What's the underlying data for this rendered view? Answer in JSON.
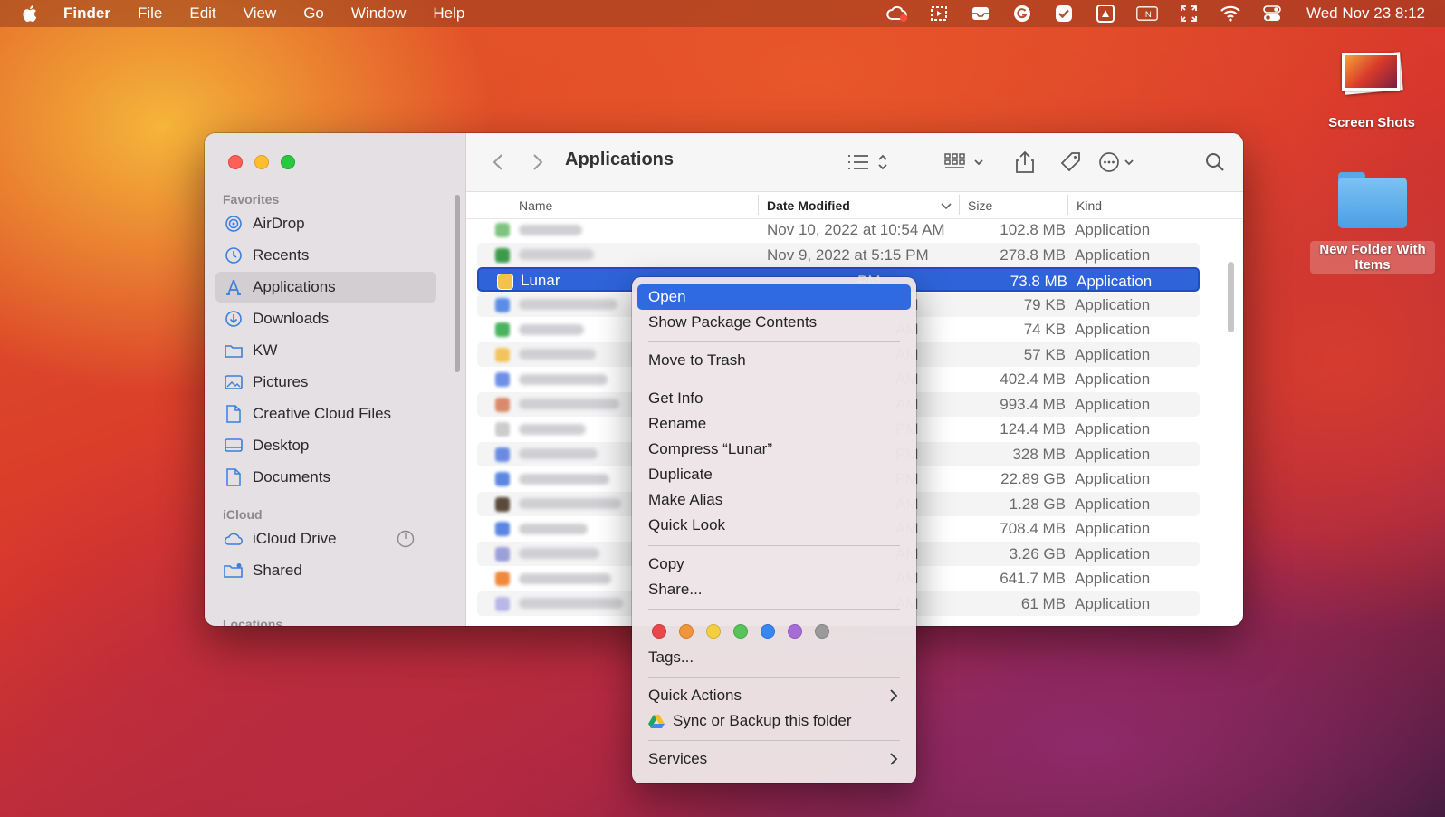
{
  "menubar": {
    "app_name": "Finder",
    "menus": [
      "File",
      "Edit",
      "View",
      "Go",
      "Window",
      "Help"
    ],
    "status_icons": [
      "creative-cloud-icon",
      "screen-capture-icon",
      "inbox-icon",
      "grammarly-icon",
      "checkmark-icon",
      "drive-icon",
      "input-source-icon",
      "fullscreen-icon",
      "wifi-icon",
      "control-center-icon"
    ],
    "input_source": "IN",
    "clock": "Wed Nov 23  8:12"
  },
  "desktop": {
    "items": [
      {
        "label": "Screen Shots"
      },
      {
        "label": "New Folder With Items"
      }
    ]
  },
  "finder": {
    "title": "Applications",
    "sidebar": {
      "favorites_label": "Favorites",
      "favorites": [
        {
          "label": "AirDrop",
          "icon": "airdrop-icon"
        },
        {
          "label": "Recents",
          "icon": "clock-icon"
        },
        {
          "label": "Applications",
          "icon": "applications-icon",
          "active": true
        },
        {
          "label": "Downloads",
          "icon": "download-icon"
        },
        {
          "label": "KW",
          "icon": "folder-icon"
        },
        {
          "label": "Pictures",
          "icon": "pictures-icon"
        },
        {
          "label": "Creative Cloud Files",
          "icon": "document-icon"
        },
        {
          "label": "Desktop",
          "icon": "desktop-icon"
        },
        {
          "label": "Documents",
          "icon": "document-icon"
        }
      ],
      "icloud_label": "iCloud",
      "icloud": [
        {
          "label": "iCloud Drive",
          "icon": "cloud-icon"
        },
        {
          "label": "Shared",
          "icon": "shared-folder-icon"
        }
      ],
      "locations_label": "Locations"
    },
    "columns": {
      "name": "Name",
      "date": "Date Modified",
      "size": "Size",
      "kind": "Kind"
    },
    "rows": [
      {
        "name": "",
        "date": "Nov 10, 2022 at 10:54 AM",
        "size": "102.8 MB",
        "kind": "Application",
        "color": "#7fc37f"
      },
      {
        "name": "",
        "date": "Nov 9, 2022 at 5:15 PM",
        "size": "278.8 MB",
        "kind": "Application",
        "color": "#3c9a4a"
      },
      {
        "name": "Lunar",
        "date": "",
        "date_tail": "PM",
        "size": "73.8 MB",
        "kind": "Application",
        "selected": true,
        "color": "#f2c14e"
      },
      {
        "name": "",
        "date_tail": "AM",
        "size": "79 KB",
        "kind": "Application",
        "color": "#5a8de8"
      },
      {
        "name": "",
        "date_tail": "AM",
        "size": "74 KB",
        "kind": "Application",
        "color": "#49b35f"
      },
      {
        "name": "",
        "date_tail": "AM",
        "size": "57 KB",
        "kind": "Application",
        "color": "#f3c45b"
      },
      {
        "name": "",
        "date_tail": "AM",
        "size": "402.4 MB",
        "kind": "Application",
        "color": "#6f8fe6"
      },
      {
        "name": "",
        "date_tail": "AM",
        "size": "993.4 MB",
        "kind": "Application",
        "color": "#d98a6a"
      },
      {
        "name": "",
        "date_tail": "PM",
        "size": "124.4 MB",
        "kind": "Application",
        "color": "#cccccc"
      },
      {
        "name": "",
        "date_tail": "PM",
        "size": "328 MB",
        "kind": "Application",
        "color": "#6a8be0"
      },
      {
        "name": "",
        "date_tail": "PM",
        "size": "22.89 GB",
        "kind": "Application",
        "color": "#5b86e2"
      },
      {
        "name": "",
        "date_tail": "AM",
        "size": "1.28 GB",
        "kind": "Application",
        "color": "#5a4a3a"
      },
      {
        "name": "",
        "date_tail": "AM",
        "size": "708.4 MB",
        "kind": "Application",
        "color": "#5a86e2"
      },
      {
        "name": "",
        "date_tail": "AM",
        "size": "3.26 GB",
        "kind": "Application",
        "color": "#9aa0d8"
      },
      {
        "name": "",
        "date_tail": "AM",
        "size": "641.7 MB",
        "kind": "Application",
        "color": "#f0893c"
      },
      {
        "name": "",
        "date_tail": "AM",
        "size": "61 MB",
        "kind": "Application",
        "color": "#b8b8e8"
      }
    ]
  },
  "context_menu": {
    "items": {
      "open": "Open",
      "show_package": "Show Package Contents",
      "move_trash": "Move to Trash",
      "get_info": "Get Info",
      "rename": "Rename",
      "compress": "Compress “Lunar”",
      "duplicate": "Duplicate",
      "make_alias": "Make Alias",
      "quick_look": "Quick Look",
      "copy": "Copy",
      "share": "Share...",
      "tags": "Tags...",
      "quick_actions": "Quick Actions",
      "sync_backup": "Sync or Backup this folder",
      "services": "Services"
    },
    "tag_colors": [
      "#e8484a",
      "#f0953a",
      "#f3cf3f",
      "#5ac25a",
      "#3a86f0",
      "#a86cd8",
      "#9a9a9a"
    ]
  }
}
